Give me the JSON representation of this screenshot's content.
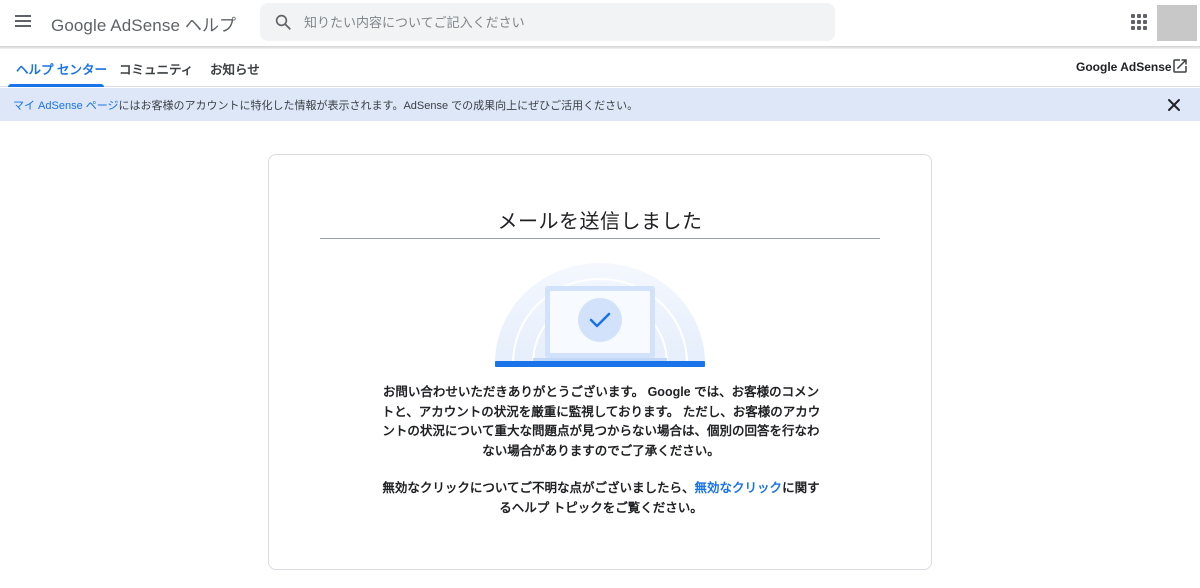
{
  "header": {
    "product_title": "Google AdSense ヘルプ",
    "search_placeholder": "知りたい内容についてご記入ください",
    "menu_icon": "menu-icon",
    "apps_icon": "apps-grid-icon",
    "search_icon": "search-icon"
  },
  "tabs": [
    {
      "label": "ヘルプ センター",
      "active": true
    },
    {
      "label": "コミュニティ",
      "active": false
    },
    {
      "label": "お知らせ",
      "active": false
    }
  ],
  "external_link": {
    "label": "Google AdSense",
    "icon": "open-in-new-icon"
  },
  "banner": {
    "link_text": "マイ AdSense ページ",
    "text": "にはお客様のアカウントに特化した情報が表示されます。AdSense での成果向上にぜひご活用ください。",
    "close_icon": "close-icon"
  },
  "card": {
    "title": "メールを送信しました",
    "paragraph1": "お問い合わせいただきありがとうございます。 Google では、お客様のコメントと、アカウントの状況を厳重に監視しております。 ただし、お客様のアカウントの状況について重大な問題点が見つからない場合は、個別の回答を行なわない場合がありますのでご了承ください。",
    "paragraph2_before": "無効なクリックについてご不明な点がございましたら、",
    "paragraph2_link": "無効なクリック",
    "paragraph2_after": "に関するヘルプ トピックをご覧ください。"
  },
  "colors": {
    "accent": "#1a73e8",
    "banner_bg": "#dde7f8",
    "search_bg": "#f1f3f4"
  }
}
